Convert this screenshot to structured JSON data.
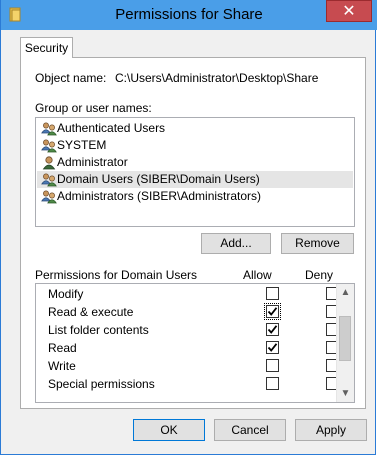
{
  "window": {
    "title": "Permissions for Share",
    "close_glyph": "✕",
    "folder_icon": "folder-icon"
  },
  "tabs": [
    {
      "label": "Security"
    }
  ],
  "object": {
    "label": "Object name:",
    "value": "C:\\Users\\Administrator\\Desktop\\Share"
  },
  "group_section": {
    "label": "Group or user names:"
  },
  "users": [
    {
      "name": "Authenticated Users",
      "icon": "users-group-icon",
      "selected": false
    },
    {
      "name": "SYSTEM",
      "icon": "users-group-icon",
      "selected": false
    },
    {
      "name": "Administrator",
      "icon": "user-icon",
      "selected": false
    },
    {
      "name": "Domain Users (SIBER\\Domain Users)",
      "icon": "users-group-icon",
      "selected": true
    },
    {
      "name": "Administrators (SIBER\\Administrators)",
      "icon": "users-group-icon",
      "selected": false
    }
  ],
  "buttons": {
    "add": "Add...",
    "remove": "Remove",
    "ok": "OK",
    "cancel": "Cancel",
    "apply": "Apply"
  },
  "permissions_header": {
    "title": "Permissions for Domain Users",
    "allow": "Allow",
    "deny": "Deny"
  },
  "permissions": [
    {
      "name": "Modify",
      "allow": false,
      "deny": false
    },
    {
      "name": "Read & execute",
      "allow": true,
      "deny": false
    },
    {
      "name": "List folder contents",
      "allow": true,
      "deny": false
    },
    {
      "name": "Read",
      "allow": true,
      "deny": false
    },
    {
      "name": "Write",
      "allow": false,
      "deny": false
    },
    {
      "name": "Special permissions",
      "allow": false,
      "deny": false
    }
  ],
  "scrollbar": {
    "up_glyph": "▲",
    "down_glyph": "▼"
  },
  "colors": {
    "titlebar": "#4a9ee8",
    "close": "#c74b50",
    "selection": "#e5e5e5"
  }
}
